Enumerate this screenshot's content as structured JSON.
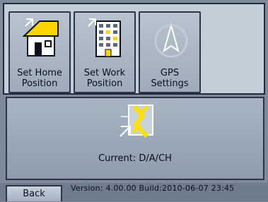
{
  "buttons": {
    "home": {
      "line1": "Set Home",
      "line2": "Position"
    },
    "work": {
      "line1": "Set Work",
      "line2": "Position"
    },
    "gps": {
      "line1": "GPS",
      "line2": "Settings"
    }
  },
  "current": {
    "text": "Current: D/A/CH"
  },
  "back": {
    "label": "Back"
  },
  "version": {
    "text": "Version: 4.00.00 Build:2010-06-07 23:45"
  },
  "colors": {
    "accent": "#ffe000",
    "background": "#7d8a9a"
  }
}
